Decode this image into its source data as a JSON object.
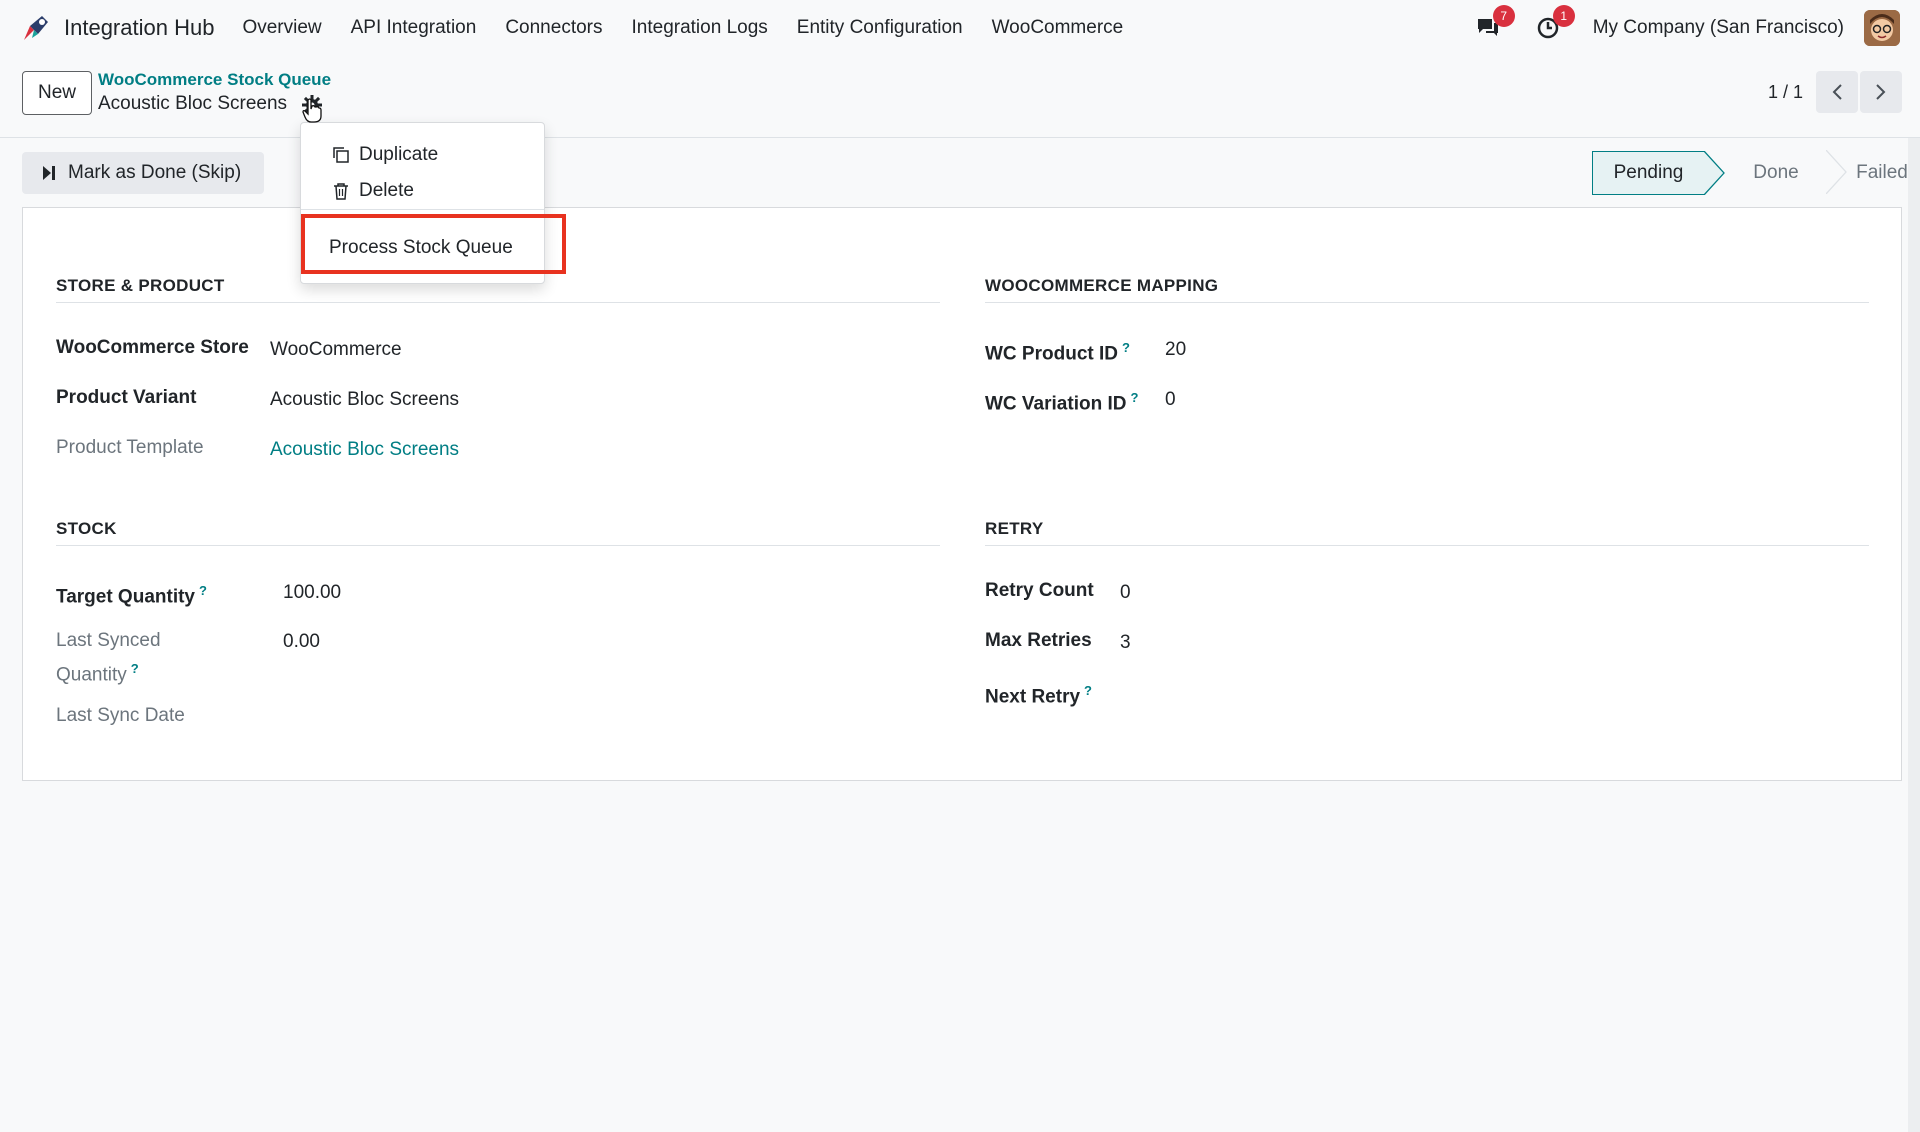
{
  "navbar": {
    "app_name": "Integration Hub",
    "menu": [
      "Overview",
      "API Integration",
      "Connectors",
      "Integration Logs",
      "Entity Configuration",
      "WooCommerce"
    ],
    "messages_badge": "7",
    "activities_badge": "1",
    "company": "My Company (San Francisco)"
  },
  "control": {
    "new_label": "New",
    "breadcrumb_parent": "WooCommerce Stock Queue",
    "breadcrumb_current": "Acoustic Bloc Screens",
    "pager": "1 / 1"
  },
  "actions": {
    "skip_label": "Mark as Done (Skip)"
  },
  "statusbar": {
    "stages": [
      "Pending",
      "Done",
      "Failed"
    ],
    "active": "Pending"
  },
  "dropdown": {
    "duplicate": "Duplicate",
    "delete": "Delete",
    "process": "Process Stock Queue"
  },
  "form": {
    "store_product": {
      "title": "STORE & PRODUCT",
      "store_label": "WooCommerce Store",
      "store_value": "WooCommerce",
      "variant_label": "Product Variant",
      "variant_value": "Acoustic Bloc Screens",
      "template_label": "Product Template",
      "template_value": "Acoustic Bloc Screens"
    },
    "mapping": {
      "title": "WOOCOMMERCE MAPPING",
      "product_id_label": "WC Product ID",
      "product_id_value": "20",
      "variation_id_label": "WC Variation ID",
      "variation_id_value": "0"
    },
    "stock": {
      "title": "STOCK",
      "target_label": "Target Quantity",
      "target_value": "100.00",
      "last_synced_label_1": "Last Synced",
      "last_synced_label_2": "Quantity",
      "last_synced_value": "0.00",
      "last_sync_date_label": "Last Sync Date"
    },
    "retry": {
      "title": "RETRY",
      "count_label": "Retry Count",
      "count_value": "0",
      "max_label": "Max Retries",
      "max_value": "3",
      "next_label": "Next Retry"
    },
    "help_mark": "?"
  },
  "colors": {
    "accent": "#017e84",
    "highlight": "#e8321f",
    "badge": "#d9303e"
  }
}
